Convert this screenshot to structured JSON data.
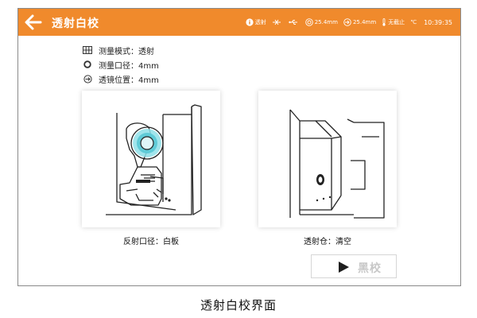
{
  "header": {
    "title": "透射白校",
    "status": {
      "mode": "透射",
      "aperture": "25.4mm",
      "lens": "25.4mm",
      "note": "无截止",
      "unit": "℃",
      "time": "10:39:35"
    }
  },
  "info": {
    "measure_mode": "测量模式：透射",
    "aperture": "测量口径：4mm",
    "lens_position": "透镜位置：4mm"
  },
  "panels": {
    "left_caption": "反射口径：白板",
    "right_caption": "透射仓：清空"
  },
  "actions": {
    "black_label": "黑校"
  },
  "figure_caption": "透射白校界面",
  "colors": {
    "accent": "#f08a2c",
    "button_text_disabled": "#c8c8c8",
    "border": "#8a8a8a"
  },
  "icons": {
    "back": "arrow-left-icon",
    "mode": "info-circle-icon",
    "bluetooth": "bluetooth-icon",
    "usb": "usb-icon",
    "aperture": "aperture-icon",
    "lens": "lens-icon",
    "thermometer": "thermometer-icon",
    "grid": "grid-icon",
    "circle": "ring-icon",
    "lens_position": "lens-position-icon",
    "play": "play-icon"
  }
}
